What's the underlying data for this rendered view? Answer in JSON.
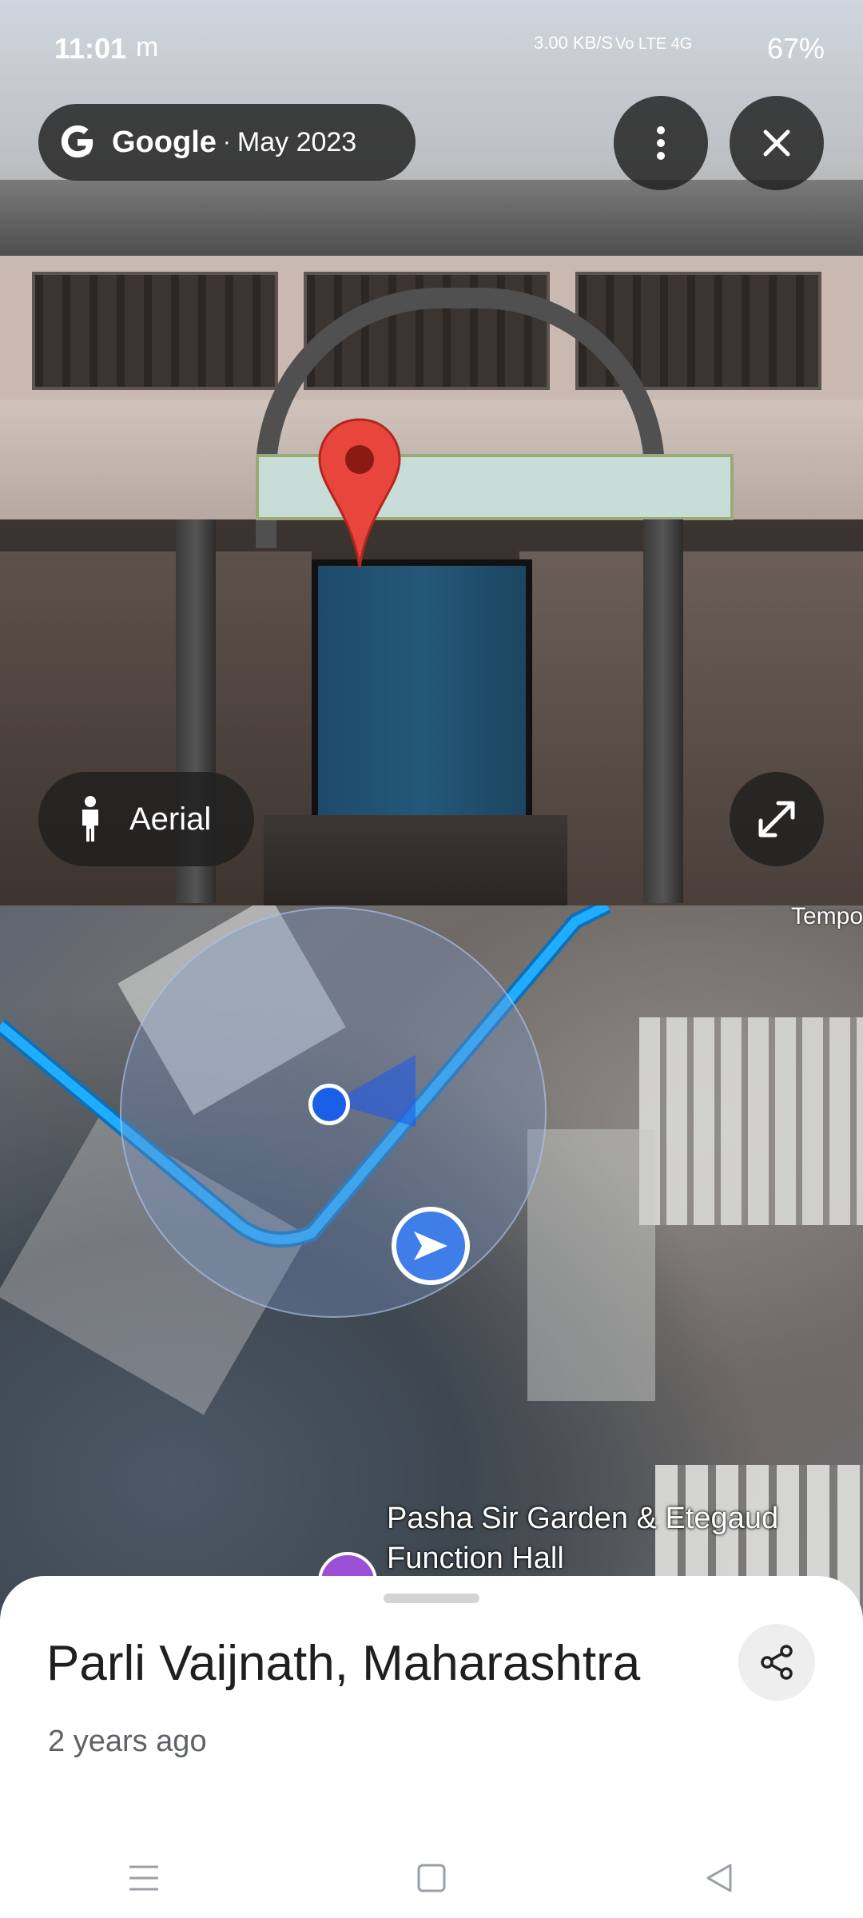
{
  "status_bar": {
    "time": "11:01",
    "carrier_icon": "m",
    "net_speed": "3.00 KB/S",
    "network": "Vo LTE 4G",
    "battery": "67%"
  },
  "streetview": {
    "source": "Google",
    "separator": "·",
    "date": "May 2023",
    "more_icon": "more-vert-icon",
    "close_icon": "close-icon",
    "aerial_label": "Aerial",
    "expand_icon": "expand-icon"
  },
  "map": {
    "edge_label": "Tempo",
    "poi_name": "Pasha Sir Garden & Etegaud Function Hall"
  },
  "sheet": {
    "title": "Parli Vaijnath, Maharashtra",
    "subtitle": "2 years ago",
    "share_icon": "share-icon"
  },
  "colors": {
    "accent_blue": "#1a5fe8",
    "route_blue": "#1faeff",
    "pin_red": "#e8453c"
  }
}
